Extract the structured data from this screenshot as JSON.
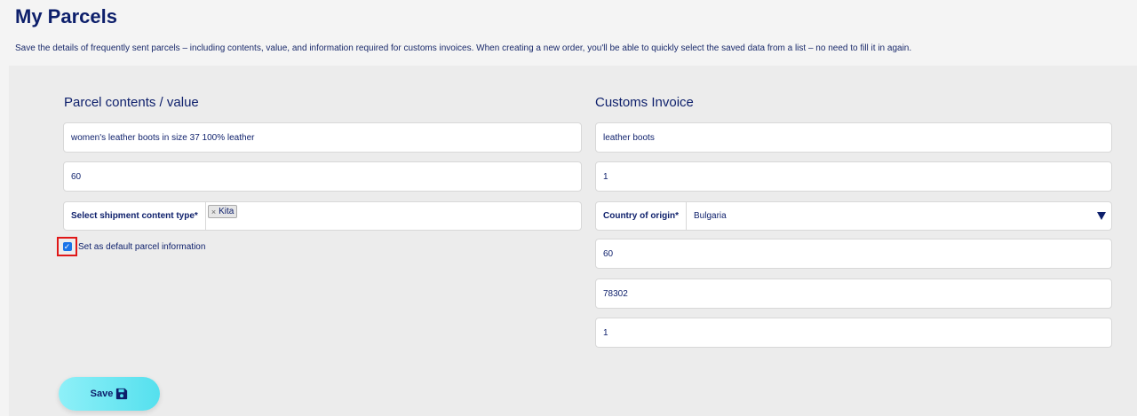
{
  "page": {
    "title": "My Parcels",
    "description": "Save the details of frequently sent parcels – including contents, value, and information required for customs invoices. When creating a new order, you'll be able to quickly select the saved data from a list – no need to fill it in again."
  },
  "parcel_section": {
    "title": "Parcel contents / value",
    "contents_value": "women's leather boots in size 37 100% leather",
    "value": "60",
    "content_type_label": "Select shipment content type*",
    "content_type_tag": "Kita",
    "tag_remove_glyph": "×",
    "default_checkbox_checked": true,
    "default_checkbox_label": "Set as default parcel information"
  },
  "customs_section": {
    "title": "Customs Invoice",
    "description_value": "leather boots",
    "quantity_value": "1",
    "country_label": "Country of origin*",
    "country_value": "Bulgaria",
    "value_field": "60",
    "hs_code": "78302",
    "weight_field": "1"
  },
  "actions": {
    "save_label": "Save",
    "save_icon": "floppy-disk-icon"
  },
  "colors": {
    "primary_text": "#0d1f6b",
    "save_button": "#55e0ee",
    "highlight_border": "#e01818",
    "checkbox": "#1a73e8"
  }
}
